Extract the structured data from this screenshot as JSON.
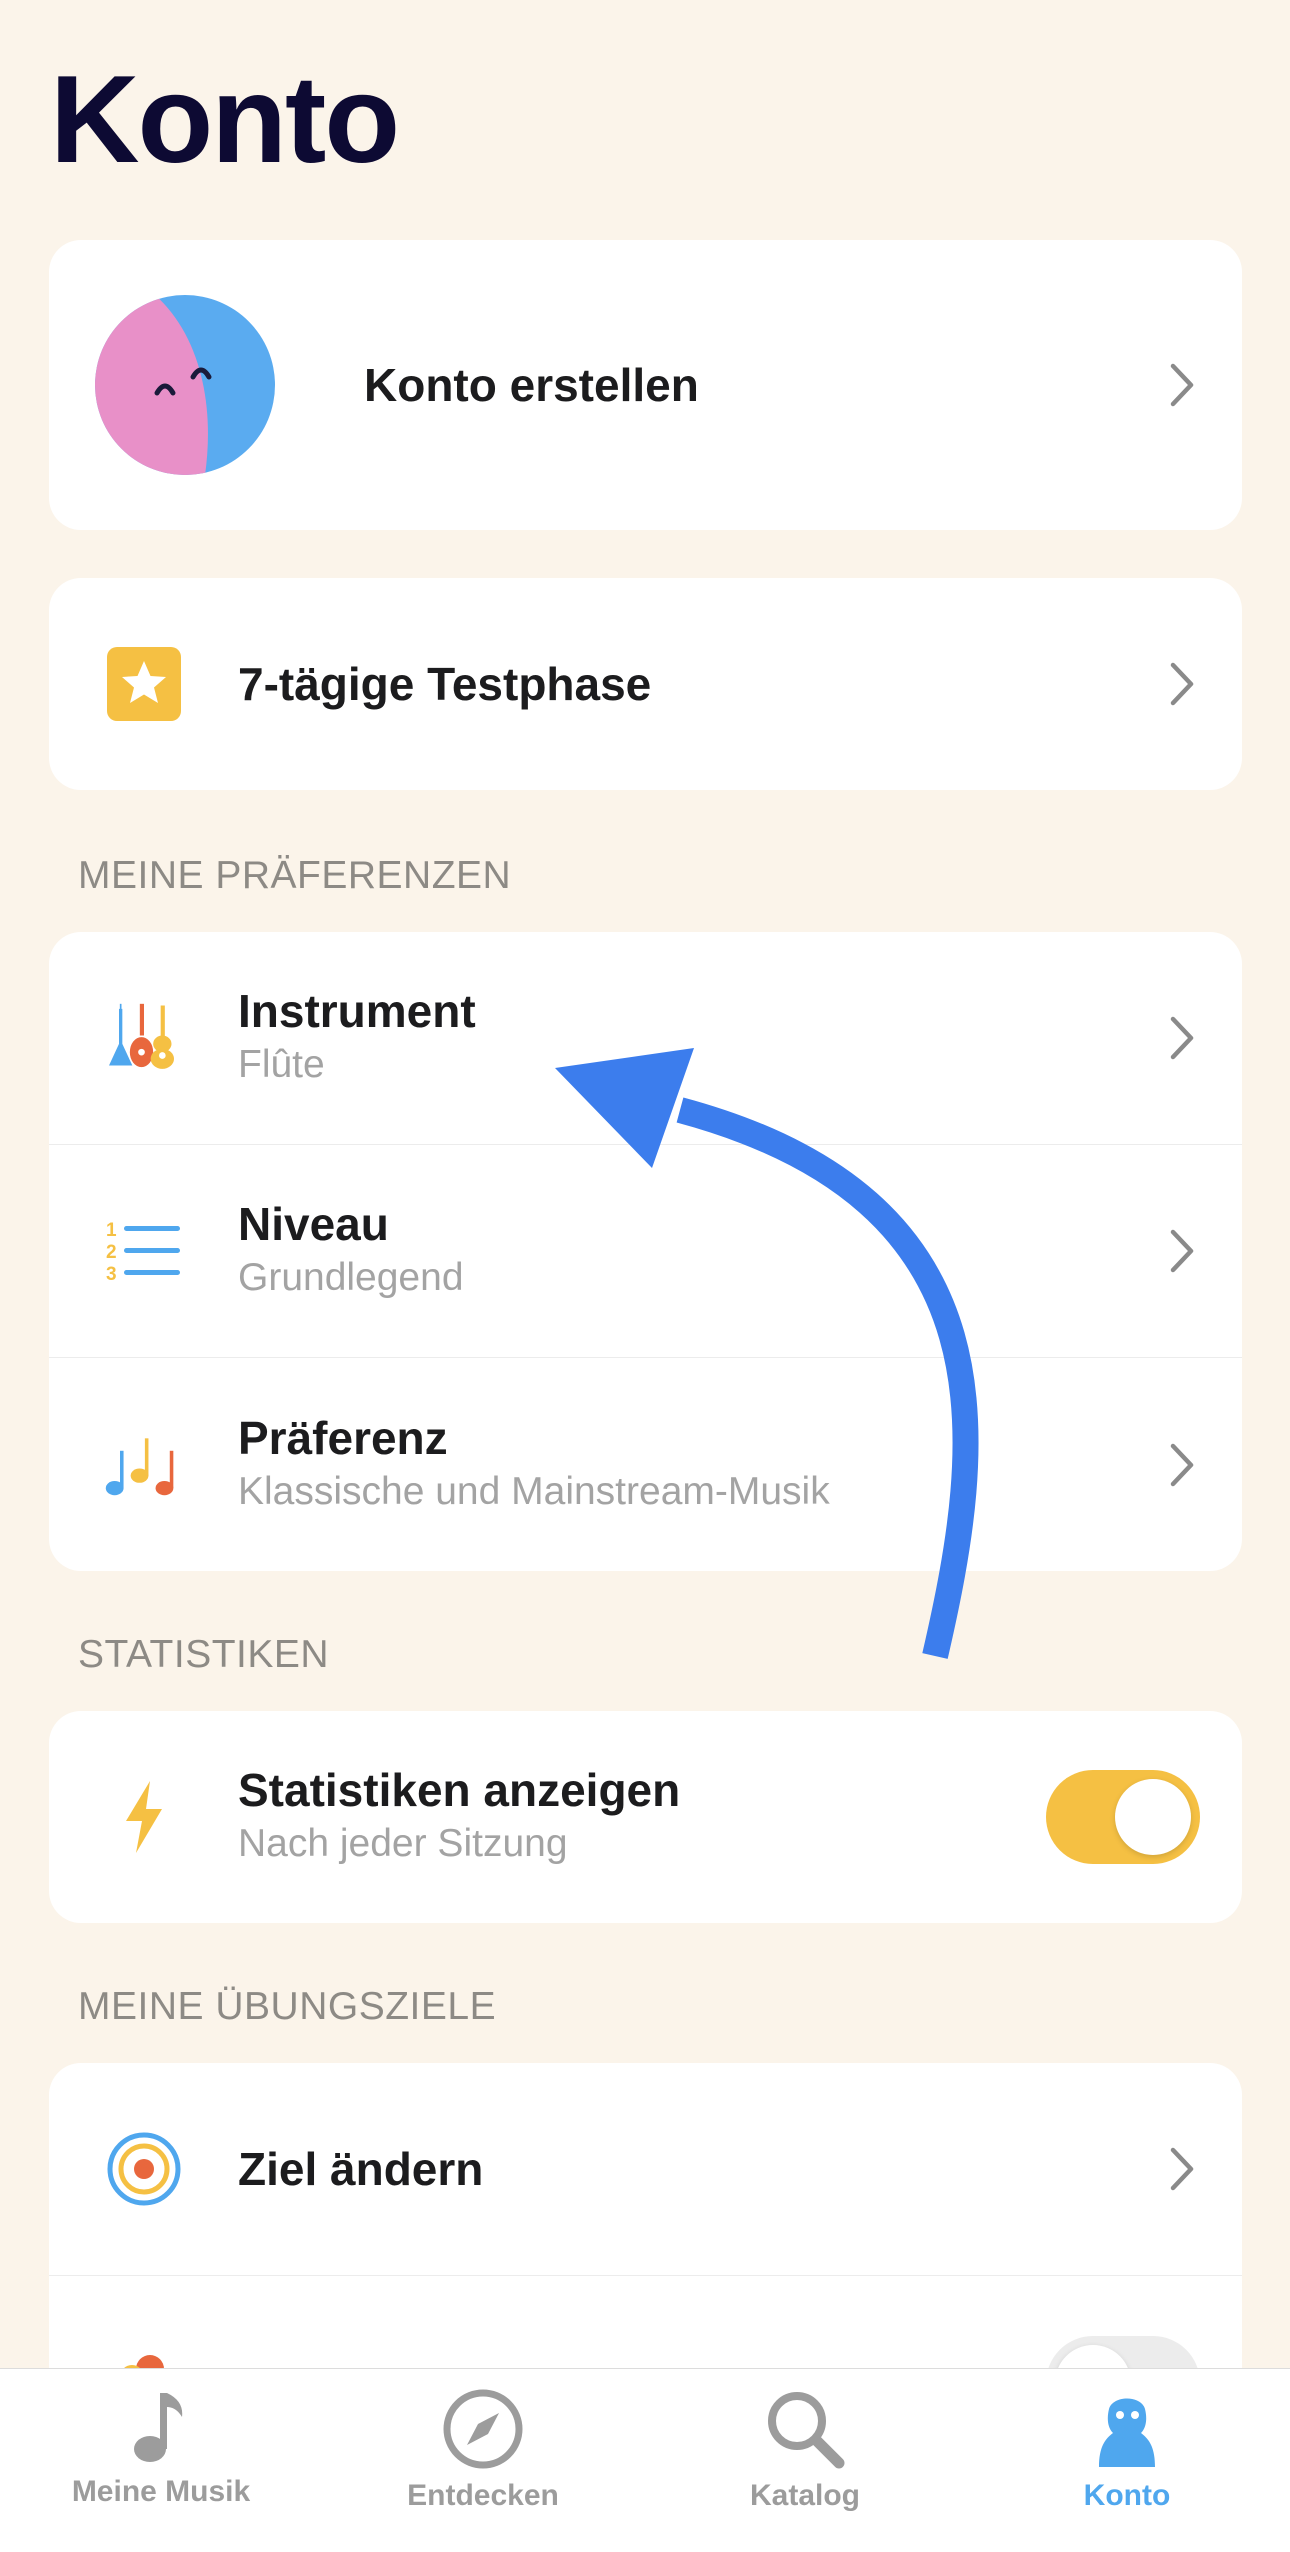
{
  "page": {
    "title": "Konto"
  },
  "account_card": {
    "label": "Konto erstellen"
  },
  "trial_card": {
    "label": "7-tägige Testphase"
  },
  "preferences": {
    "section_label": "MEINE PRÄFERENZEN",
    "items": [
      {
        "title": "Instrument",
        "subtitle": "Flûte",
        "icon": "guitars-icon"
      },
      {
        "title": "Niveau",
        "subtitle": "Grundlegend",
        "icon": "numbered-list-icon"
      },
      {
        "title": "Präferenz",
        "subtitle": "Klassische und Mainstream-Musik",
        "icon": "music-notes-icon"
      }
    ]
  },
  "statistics": {
    "section_label": "STATISTIKEN",
    "title": "Statistiken anzeigen",
    "subtitle": "Nach jeder Sitzung",
    "toggle_on": true
  },
  "goals": {
    "section_label": "MEINE ÜBUNGSZIELE",
    "items": [
      {
        "title": "Ziel ändern",
        "icon": "target-icon"
      }
    ]
  },
  "tabbar": {
    "items": [
      {
        "label": "Meine Musik",
        "icon": "music-note-icon",
        "active": false
      },
      {
        "label": "Entdecken",
        "icon": "compass-icon",
        "active": false
      },
      {
        "label": "Katalog",
        "icon": "search-icon",
        "active": false
      },
      {
        "label": "Konto",
        "icon": "person-icon",
        "active": true
      }
    ]
  },
  "colors": {
    "background": "#fbf4ea",
    "accent_yellow": "#f5c043",
    "accent_blue": "#4fa7ee",
    "arrow_blue": "#3c7ded",
    "title_navy": "#0d0a33"
  }
}
